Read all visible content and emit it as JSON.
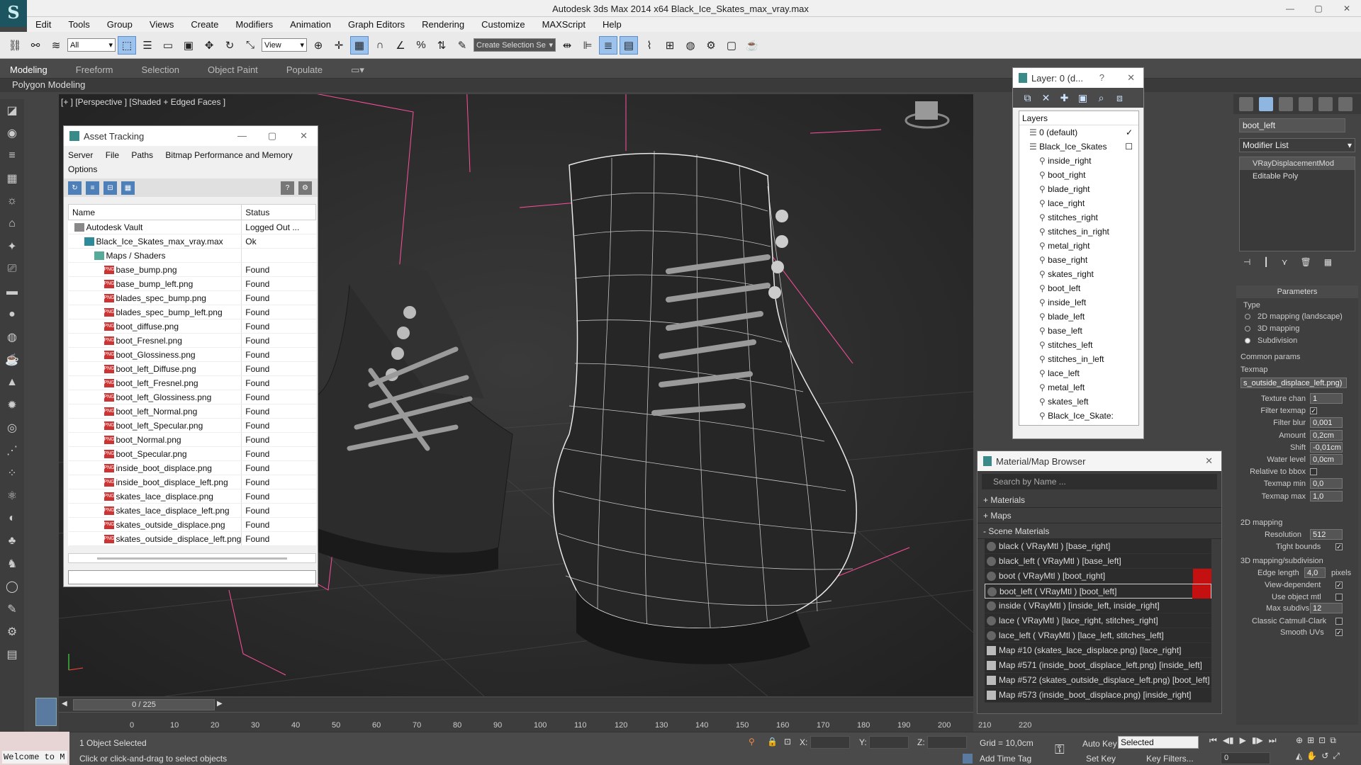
{
  "app": {
    "title": "Autodesk 3ds Max  2014 x64    Black_Ice_Skates_max_vray.max",
    "window_buttons": [
      "—",
      "▢",
      "✕"
    ]
  },
  "menu": [
    "Edit",
    "Tools",
    "Group",
    "Views",
    "Create",
    "Modifiers",
    "Animation",
    "Graph Editors",
    "Rendering",
    "Customize",
    "MAXScript",
    "Help"
  ],
  "toolbar": {
    "filter": "All",
    "refcoord": "View",
    "selection_set": "Create Selection Se"
  },
  "ribbon": {
    "tabs": [
      "Modeling",
      "Freeform",
      "Selection",
      "Object Paint",
      "Populate"
    ],
    "active_tab": "Modeling",
    "panel": "Polygon Modeling"
  },
  "viewport": {
    "label": "[+ ] [Perspective ] [Shaded + Edged Faces ]"
  },
  "asset_tracking": {
    "title": "Asset Tracking",
    "menu": [
      "Server",
      "File",
      "Paths",
      "Bitmap Performance and Memory"
    ],
    "menu2": "Options",
    "columns": [
      "Name",
      "Status"
    ],
    "rows": [
      {
        "name": "Autodesk Vault",
        "status": "Logged Out ...",
        "level": 0,
        "kind": "vault"
      },
      {
        "name": "Black_Ice_Skates_max_vray.max",
        "status": "Ok",
        "level": 1,
        "kind": "max"
      },
      {
        "name": "Maps / Shaders",
        "status": "",
        "level": 2,
        "kind": "folder"
      },
      {
        "name": "base_bump.png",
        "status": "Found",
        "level": 3,
        "kind": "png"
      },
      {
        "name": "base_bump_left.png",
        "status": "Found",
        "level": 3,
        "kind": "png"
      },
      {
        "name": "blades_spec_bump.png",
        "status": "Found",
        "level": 3,
        "kind": "png"
      },
      {
        "name": "blades_spec_bump_left.png",
        "status": "Found",
        "level": 3,
        "kind": "png"
      },
      {
        "name": "boot_diffuse.png",
        "status": "Found",
        "level": 3,
        "kind": "png"
      },
      {
        "name": "boot_Fresnel.png",
        "status": "Found",
        "level": 3,
        "kind": "png"
      },
      {
        "name": "boot_Glossiness.png",
        "status": "Found",
        "level": 3,
        "kind": "png"
      },
      {
        "name": "boot_left_Diffuse.png",
        "status": "Found",
        "level": 3,
        "kind": "png"
      },
      {
        "name": "boot_left_Fresnel.png",
        "status": "Found",
        "level": 3,
        "kind": "png"
      },
      {
        "name": "boot_left_Glossiness.png",
        "status": "Found",
        "level": 3,
        "kind": "png"
      },
      {
        "name": "boot_left_Normal.png",
        "status": "Found",
        "level": 3,
        "kind": "png"
      },
      {
        "name": "boot_left_Specular.png",
        "status": "Found",
        "level": 3,
        "kind": "png"
      },
      {
        "name": "boot_Normal.png",
        "status": "Found",
        "level": 3,
        "kind": "png"
      },
      {
        "name": "boot_Specular.png",
        "status": "Found",
        "level": 3,
        "kind": "png"
      },
      {
        "name": "inside_boot_displace.png",
        "status": "Found",
        "level": 3,
        "kind": "png"
      },
      {
        "name": "inside_boot_displace_left.png",
        "status": "Found",
        "level": 3,
        "kind": "png"
      },
      {
        "name": "skates_lace_displace.png",
        "status": "Found",
        "level": 3,
        "kind": "png"
      },
      {
        "name": "skates_lace_displace_left.png",
        "status": "Found",
        "level": 3,
        "kind": "png"
      },
      {
        "name": "skates_outside_displace.png",
        "status": "Found",
        "level": 3,
        "kind": "png"
      },
      {
        "name": "skates_outside_displace_left.png",
        "status": "Found",
        "level": 3,
        "kind": "png"
      }
    ]
  },
  "layers": {
    "title": "Layer: 0 (d...",
    "help": "?",
    "header": "Layers",
    "items": [
      {
        "name": "0 (default)",
        "level": 0,
        "mark": "✓"
      },
      {
        "name": "Black_Ice_Skates",
        "level": 0,
        "mark": "☐"
      },
      {
        "name": "inside_right",
        "level": 1,
        "mark": ""
      },
      {
        "name": "boot_right",
        "level": 1,
        "mark": ""
      },
      {
        "name": "blade_right",
        "level": 1,
        "mark": ""
      },
      {
        "name": "lace_right",
        "level": 1,
        "mark": ""
      },
      {
        "name": "stitches_right",
        "level": 1,
        "mark": ""
      },
      {
        "name": "stitches_in_right",
        "level": 1,
        "mark": ""
      },
      {
        "name": "metal_right",
        "level": 1,
        "mark": ""
      },
      {
        "name": "base_right",
        "level": 1,
        "mark": ""
      },
      {
        "name": "skates_right",
        "level": 1,
        "mark": ""
      },
      {
        "name": "boot_left",
        "level": 1,
        "mark": ""
      },
      {
        "name": "inside_left",
        "level": 1,
        "mark": ""
      },
      {
        "name": "blade_left",
        "level": 1,
        "mark": ""
      },
      {
        "name": "base_left",
        "level": 1,
        "mark": ""
      },
      {
        "name": "stitches_left",
        "level": 1,
        "mark": ""
      },
      {
        "name": "stitches_in_left",
        "level": 1,
        "mark": ""
      },
      {
        "name": "lace_left",
        "level": 1,
        "mark": ""
      },
      {
        "name": "metal_left",
        "level": 1,
        "mark": ""
      },
      {
        "name": "skates_left",
        "level": 1,
        "mark": ""
      },
      {
        "name": "Black_Ice_Skate:",
        "level": 1,
        "mark": ""
      }
    ]
  },
  "material_browser": {
    "title": "Material/Map Browser",
    "search_placeholder": "Search by Name ...",
    "sections": [
      "+ Materials",
      "+ Maps",
      "- Scene Materials"
    ],
    "items": [
      {
        "label": "black  ( VRayMtl ) [base_right]",
        "kind": "mtl",
        "red": false,
        "selected": false
      },
      {
        "label": "black_left  ( VRayMtl ) [base_left]",
        "kind": "mtl",
        "red": false,
        "selected": false
      },
      {
        "label": "boot  ( VRayMtl ) [boot_right]",
        "kind": "mtl",
        "red": true,
        "selected": false
      },
      {
        "label": "boot_left  ( VRayMtl ) [boot_left]",
        "kind": "mtl",
        "red": true,
        "selected": true
      },
      {
        "label": "inside  ( VRayMtl ) [inside_left, inside_right]",
        "kind": "mtl",
        "red": false,
        "selected": false
      },
      {
        "label": "lace  ( VRayMtl ) [lace_right, stitches_right]",
        "kind": "mtl",
        "red": false,
        "selected": false
      },
      {
        "label": "lace_left  ( VRayMtl ) [lace_left, stitches_left]",
        "kind": "mtl",
        "red": false,
        "selected": false
      },
      {
        "label": "Map #10 (skates_lace_displace.png) [lace_right]",
        "kind": "map",
        "red": false,
        "selected": false
      },
      {
        "label": "Map #571 (inside_boot_displace_left.png) [inside_left]",
        "kind": "map",
        "red": false,
        "selected": false
      },
      {
        "label": "Map #572 (skates_outside_displace_left.png) [boot_left]",
        "kind": "map",
        "red": false,
        "selected": false
      },
      {
        "label": "Map #573 (inside_boot_displace.png) [inside_right]",
        "kind": "map",
        "red": false,
        "selected": false
      }
    ]
  },
  "command_panel": {
    "object_name": "boot_left",
    "modifier_list": "Modifier List",
    "stack": [
      "VRayDisplacementMod",
      "Editable Poly"
    ],
    "rollout": "Parameters",
    "type_label": "Type",
    "types": [
      "2D mapping (landscape)",
      "3D mapping",
      "Subdivision"
    ],
    "common": "Common params",
    "texmap_label": "Texmap",
    "texmap": "s_outside_displace_left.png)",
    "params": [
      {
        "label": "Texture chan",
        "value": "1"
      },
      {
        "label": "Filter texmap",
        "value": "✓"
      },
      {
        "label": "Filter blur",
        "value": "0,001"
      },
      {
        "label": "Amount",
        "value": "0,2cm"
      },
      {
        "label": "Shift",
        "value": "-0,01cm"
      },
      {
        "label": "Water level",
        "value": "0,0cm"
      },
      {
        "label": "Relative to bbox",
        "value": ""
      },
      {
        "label": "Texmap min",
        "value": "0,0"
      },
      {
        "label": "Texmap max",
        "value": "1,0"
      }
    ],
    "mapping2d": "2D mapping",
    "resolution_label": "Resolution",
    "resolution": "512",
    "tight_bounds": "Tight bounds",
    "mapping3d": "3D mapping/subdivision",
    "edge_length_label": "Edge length",
    "edge_length": "4,0",
    "pixels": "pixels",
    "view_dependent": "View-dependent",
    "use_object_mtl": "Use object mtl",
    "max_subdivs_label": "Max subdivs",
    "max_subdivs": "12",
    "catmull": "Classic Catmull-Clark",
    "smooth_uvs": "Smooth UVs"
  },
  "timeline": {
    "frame": "0 / 225",
    "ticks": [
      "0",
      "10",
      "20",
      "30",
      "40",
      "50",
      "60",
      "70",
      "80",
      "90",
      "100",
      "110",
      "120",
      "130",
      "140",
      "150",
      "160",
      "170",
      "180",
      "190",
      "200",
      "210",
      "220"
    ]
  },
  "status": {
    "welcome": "Welcome to M",
    "selected": "1 Object Selected",
    "hint": "Click or click-and-drag to select objects",
    "x_label": "X:",
    "y_label": "Y:",
    "z_label": "Z:",
    "grid": "Grid = 10,0cm",
    "add_time_tag": "Add Time Tag",
    "auto_key": "Auto Key",
    "key_mode": "Selected",
    "set_key": "Set Key",
    "key_filters": "Key Filters...",
    "frame_field": "0"
  }
}
